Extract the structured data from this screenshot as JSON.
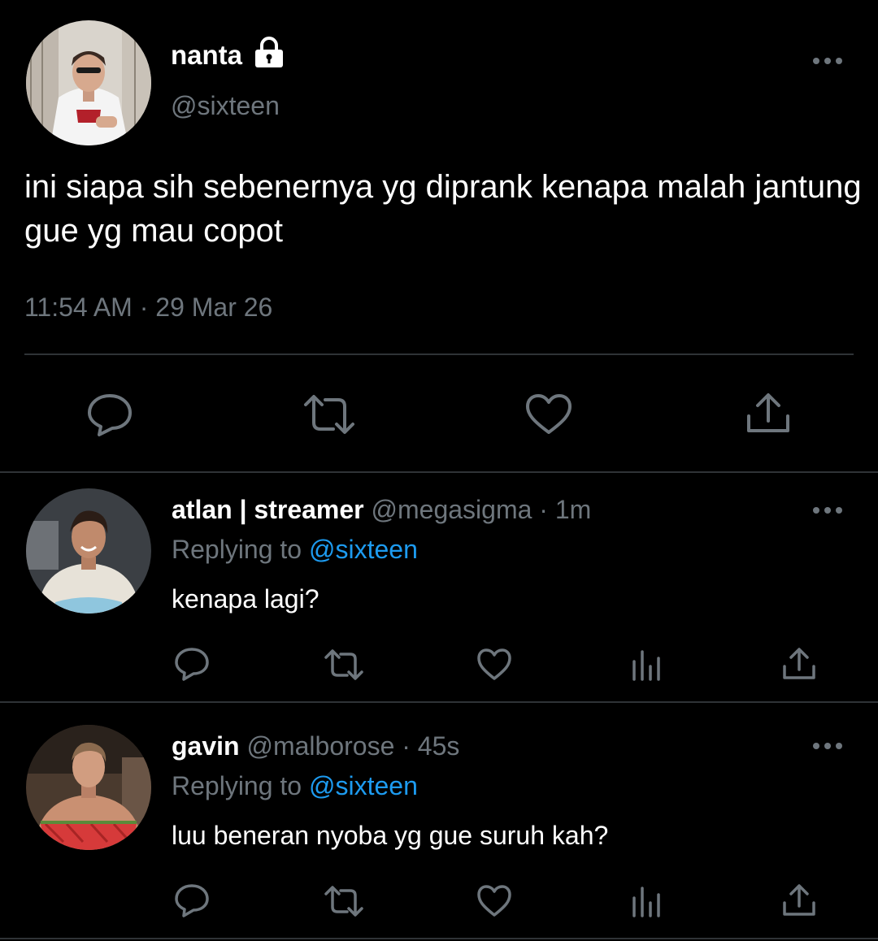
{
  "main_tweet": {
    "author_name": "nanta",
    "author_handle": "@sixteen",
    "text": "ini siapa sih sebenernya yg diprank kenapa malah jantung gue yg mau copot",
    "timestamp": "11:54 AM · 29 Mar 26",
    "icons": [
      "lock-icon",
      "more-icon",
      "reply-icon",
      "retweet-icon",
      "like-icon",
      "share-icon"
    ]
  },
  "replies": [
    {
      "name": "atlan | streamer",
      "handle": "@megasigma",
      "time": "1m",
      "replying_label": "Replying to",
      "replying_to": "@sixteen",
      "text": "kenapa lagi?"
    },
    {
      "name": "gavin",
      "handle": "@malborose",
      "time": "45s",
      "replying_label": "Replying to",
      "replying_to": "@sixteen",
      "text": "luu beneran nyoba yg gue suruh kah?"
    }
  ],
  "colors": {
    "background": "#000000",
    "text": "#ffffff",
    "secondary": "#6e767d",
    "accent": "#1d9bf0",
    "divider": "#2f3336"
  }
}
